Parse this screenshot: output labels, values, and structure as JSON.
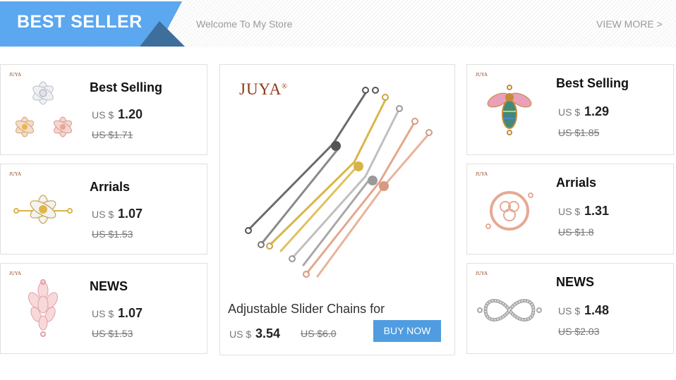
{
  "header": {
    "title": "BEST SELLER",
    "welcome": "Welcome To My Store",
    "view_more": "VIEW MORE >"
  },
  "brand": "JUYA",
  "currency_prefix": "US $",
  "left_cards": [
    {
      "name": "Best Selling",
      "price": "1.20",
      "old_price": "US $1.71",
      "icon": "flower-connectors-icon"
    },
    {
      "name": "Arrials",
      "price": "1.07",
      "old_price": "US $1.53",
      "icon": "flower-connector-icon"
    },
    {
      "name": "NEWS",
      "price": "1.07",
      "old_price": "US $1.53",
      "icon": "leaf-pendant-icon"
    }
  ],
  "center": {
    "title": "Adjustable Slider Chains for",
    "price": "3.54",
    "old_price": "US $6.0",
    "buy_label": "BUY NOW",
    "icon": "slider-chains-icon"
  },
  "right_cards": [
    {
      "name": "Best Selling",
      "price": "1.29",
      "old_price": "US $1.85",
      "icon": "bee-charm-icon"
    },
    {
      "name": "Arrials",
      "price": "1.31",
      "old_price": "US $1.8",
      "icon": "round-connector-icon"
    },
    {
      "name": "NEWS",
      "price": "1.48",
      "old_price": "US $2.03",
      "icon": "infinity-connector-icon"
    }
  ],
  "colors": {
    "accent": "#5ba7f0",
    "accent_dark": "#3d6e9c",
    "button": "#4f9ce0",
    "brand": "#8b3a1a"
  }
}
